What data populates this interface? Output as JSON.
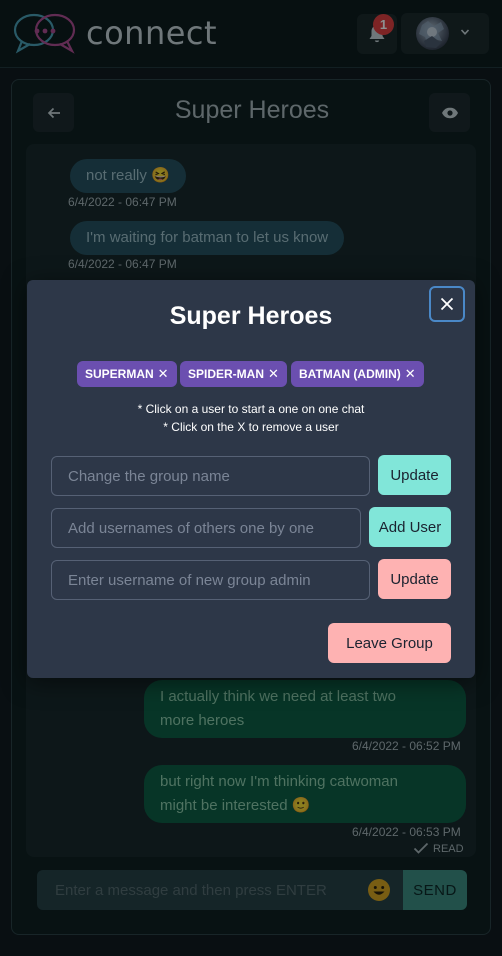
{
  "header": {
    "brand": "connect",
    "notification_count": "1",
    "icons": [
      "chat-bubbles-logo",
      "bell-icon",
      "chevron-down-icon"
    ]
  },
  "chat": {
    "title": "Super Heroes",
    "messages": [
      {
        "text": "not really 😆",
        "time": "6/4/2022 - 06:47 PM",
        "direction": "incoming"
      },
      {
        "text": "I'm waiting for batman to let us know",
        "time": "6/4/2022 - 06:47 PM",
        "direction": "incoming"
      },
      {
        "line1": "I actually think we need at least two",
        "line2": "more heroes",
        "time": "6/4/2022 - 06:52 PM",
        "direction": "outgoing"
      },
      {
        "line1": "but right now I'm thinking catwoman",
        "line2": "might be interested 🙂",
        "time": "6/4/2022 - 06:53 PM",
        "direction": "outgoing"
      }
    ],
    "read_label": "READ",
    "composer": {
      "placeholder": "Enter a message and then press ENTER",
      "send_label": "SEND"
    }
  },
  "modal": {
    "title": "Super Heroes",
    "members": [
      "SUPERMAN",
      "SPIDER-MAN",
      "BATMAN (ADMIN)"
    ],
    "hint1": "* Click on a user to start a one on one chat",
    "hint2": "* Click on the X to remove a user",
    "rename": {
      "placeholder": "Change the group name",
      "button": "Update"
    },
    "add_user": {
      "placeholder": "Add usernames of others one by one",
      "button": "Add User"
    },
    "new_admin": {
      "placeholder": "Enter username of new group admin",
      "button": "Update"
    },
    "leave_label": "Leave Group"
  },
  "colors": {
    "accent_teal": "#81e6d9",
    "accent_pink": "#feb2b2",
    "chip_purple": "#6b4fb0",
    "modal_bg": "#2d3748",
    "incoming_bubble": "#254e5c",
    "outgoing_bubble": "#0b5a3e"
  }
}
